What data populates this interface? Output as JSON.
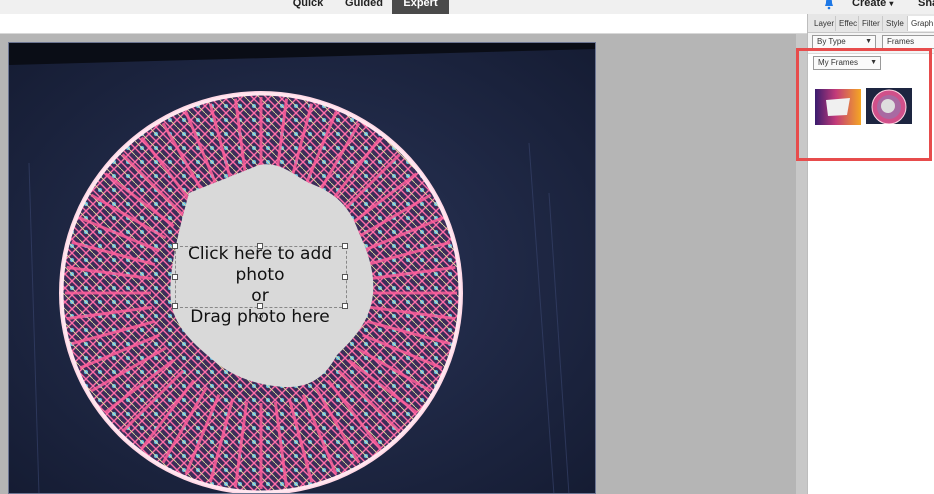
{
  "topbar": {
    "modes": [
      "Quick",
      "Guided",
      "Expert"
    ],
    "active_mode": "Expert",
    "create_label": "Create",
    "share_label": "Sha"
  },
  "panel": {
    "tabs": [
      "Layer",
      "Effec",
      "Filter",
      "Style",
      "Graph"
    ],
    "active_tab": "Graph",
    "filter_by": "By Type",
    "category": "Frames",
    "collection": "My Frames",
    "thumbnails": [
      "gradient-frame",
      "mandala-frame"
    ]
  },
  "canvas": {
    "placeholder_line1": "Click here to add photo",
    "placeholder_line2": "or",
    "placeholder_line3": "Drag photo here"
  },
  "colors": {
    "highlight": "#e74c4c",
    "active_tab": "#4a4a4a",
    "bell": "#1e78e6"
  }
}
